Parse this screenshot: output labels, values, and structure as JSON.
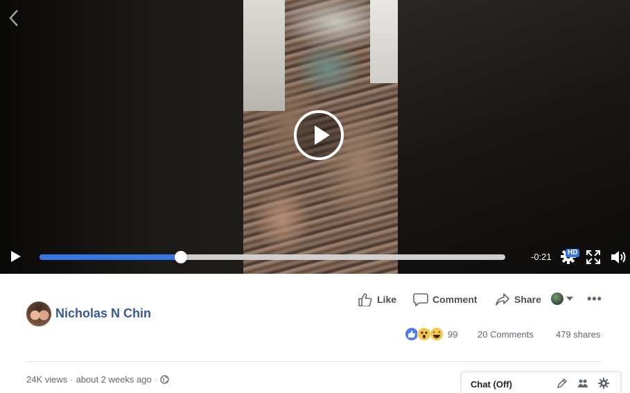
{
  "video": {
    "time_remaining": "-0:21",
    "progress_fraction": 0.304,
    "hd_badge": "HD"
  },
  "actions": {
    "like_label": "Like",
    "comment_label": "Comment",
    "share_label": "Share"
  },
  "post": {
    "author_name": "Nicholas N Chin",
    "reaction_count": "99",
    "comments": "20 Comments",
    "shares": "479 shares",
    "views": "24K views",
    "separator": "·",
    "time_ago": "about 2 weeks ago"
  },
  "chat": {
    "label": "Chat (Off)"
  },
  "colors": {
    "progress_fill": "#3578e5",
    "author_link": "#385898",
    "like_reaction": "#4d7cf2"
  }
}
